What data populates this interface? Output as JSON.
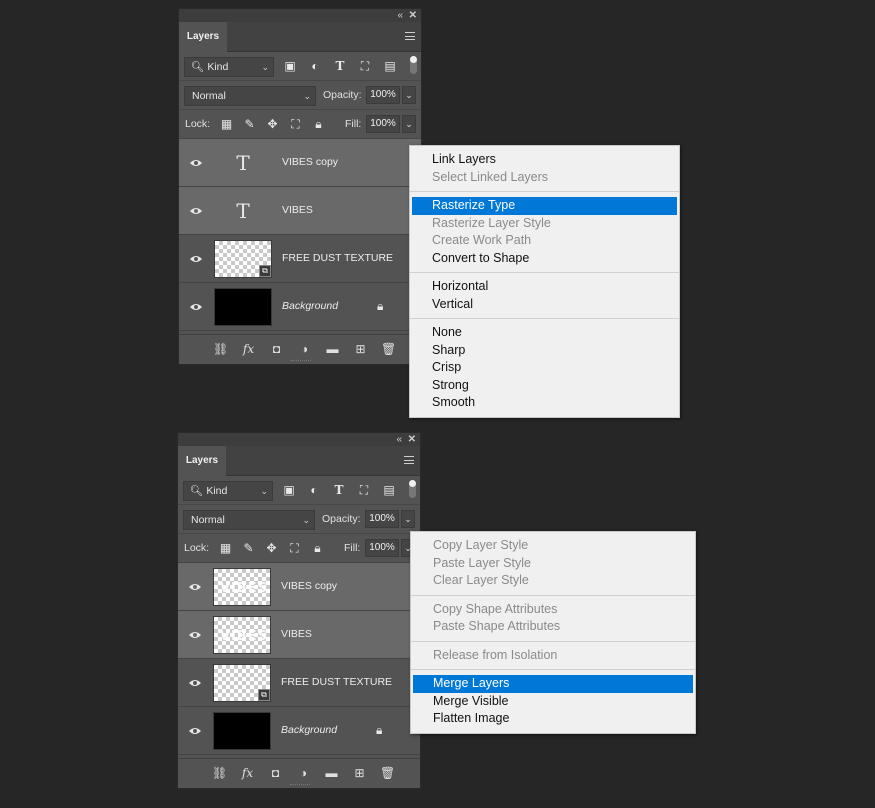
{
  "panels": [
    {
      "tab_label": "Layers",
      "filter_label": "Kind",
      "blend_mode": "Normal",
      "opacity_label": "Opacity:",
      "opacity_value": "100%",
      "lock_label": "Lock:",
      "fill_label": "Fill:",
      "fill_value": "100%",
      "layers": [
        {
          "name": "VIBES copy",
          "thumb": "type",
          "thumb_char": "T",
          "selected": true
        },
        {
          "name": "VIBES",
          "thumb": "type",
          "thumb_char": "T",
          "selected": true
        },
        {
          "name": "FREE DUST TEXTURE",
          "thumb": "checker-smart",
          "selected": false
        },
        {
          "name": "Background",
          "thumb": "black",
          "selected": false,
          "locked": true
        }
      ]
    },
    {
      "tab_label": "Layers",
      "filter_label": "Kind",
      "blend_mode": "Normal",
      "opacity_label": "Opacity:",
      "opacity_value": "100%",
      "lock_label": "Lock:",
      "fill_label": "Fill:",
      "fill_value": "100%",
      "layers": [
        {
          "name": "VIBES copy",
          "thumb": "raster-text",
          "selected": true
        },
        {
          "name": "VIBES",
          "thumb": "raster-text",
          "selected": true
        },
        {
          "name": "FREE DUST TEXTURE",
          "thumb": "checker-smart",
          "selected": false
        },
        {
          "name": "Background",
          "thumb": "black",
          "selected": false,
          "locked": true
        }
      ]
    }
  ],
  "context_menu_1": {
    "groups": [
      [
        {
          "label": "Link Layers",
          "disabled": false
        },
        {
          "label": "Select Linked Layers",
          "disabled": true
        }
      ],
      [
        {
          "label": "Rasterize Type",
          "highlighted": true
        },
        {
          "label": "Rasterize Layer Style",
          "disabled": true
        },
        {
          "label": "Create Work Path",
          "disabled": true
        },
        {
          "label": "Convert to Shape",
          "disabled": false
        }
      ],
      [
        {
          "label": "Horizontal"
        },
        {
          "label": "Vertical"
        }
      ],
      [
        {
          "label": "None"
        },
        {
          "label": "Sharp"
        },
        {
          "label": "Crisp"
        },
        {
          "label": "Strong"
        },
        {
          "label": "Smooth"
        }
      ]
    ]
  },
  "context_menu_2": {
    "groups": [
      [
        {
          "label": "Copy Layer Style",
          "disabled": true
        },
        {
          "label": "Paste Layer Style",
          "disabled": true
        },
        {
          "label": "Clear Layer Style",
          "disabled": true
        }
      ],
      [
        {
          "label": "Copy Shape Attributes",
          "disabled": true
        },
        {
          "label": "Paste Shape Attributes",
          "disabled": true
        }
      ],
      [
        {
          "label": "Release from Isolation",
          "disabled": true
        }
      ],
      [
        {
          "label": "Merge Layers",
          "highlighted": true
        },
        {
          "label": "Merge Visible"
        },
        {
          "label": "Flatten Image"
        }
      ]
    ]
  },
  "raster_text": "VIBES",
  "colors": {
    "highlight": "#0078d7",
    "panel_bg": "#535353",
    "selected_layer": "#696969",
    "app_bg": "#262626"
  }
}
